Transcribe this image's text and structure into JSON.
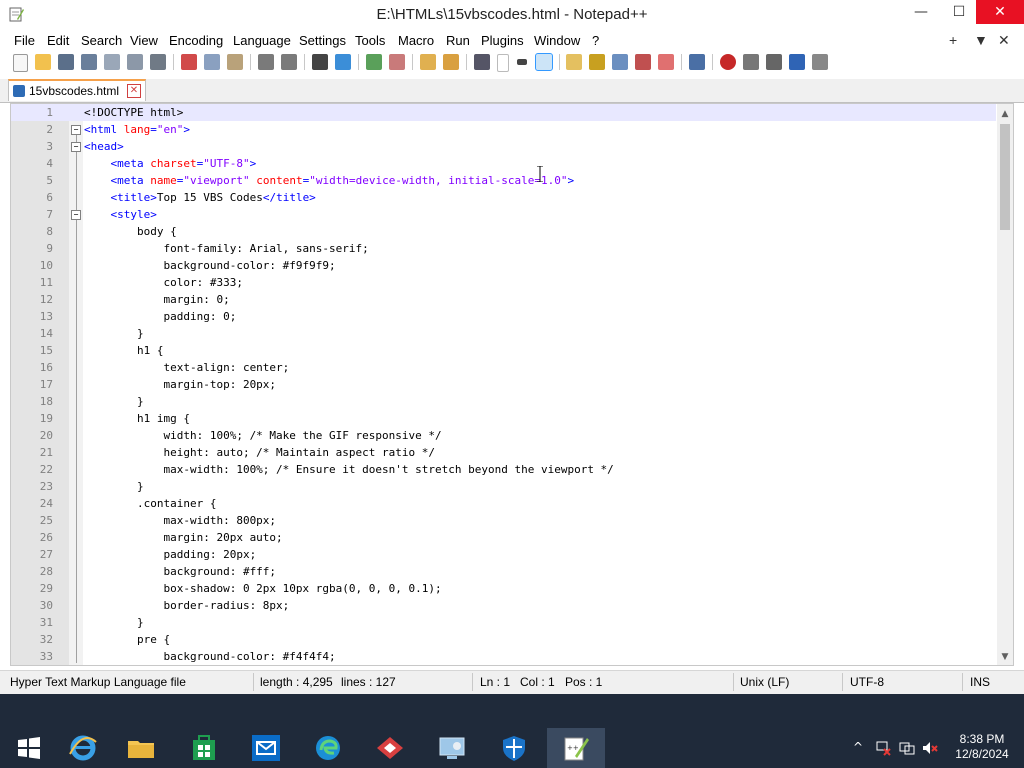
{
  "window": {
    "title": "E:\\HTMLs\\15vbscodes.html - Notepad++",
    "minimize_glyph": "—",
    "maximize_glyph": "☐",
    "close_glyph": "✕"
  },
  "menu": {
    "items": [
      "File",
      "Edit",
      "Search",
      "View",
      "Encoding",
      "Language",
      "Settings",
      "Tools",
      "Macro",
      "Run",
      "Plugins",
      "Window",
      "?"
    ],
    "right": [
      "+",
      "▼",
      "✕"
    ]
  },
  "tab": {
    "label": "15vbscodes.html",
    "close_glyph": "✕"
  },
  "editor": {
    "lines": [
      [
        [
          "doc",
          "<!DOCTYPE html>"
        ]
      ],
      [
        [
          "tag",
          "<html "
        ],
        [
          "attr",
          "lang"
        ],
        [
          "tag",
          "="
        ],
        [
          "val",
          "\"en\""
        ],
        [
          "tag",
          ">"
        ]
      ],
      [
        [
          "tag",
          "<head>"
        ]
      ],
      [
        [
          "sp",
          "    "
        ],
        [
          "tag",
          "<meta "
        ],
        [
          "attr",
          "charset"
        ],
        [
          "tag",
          "="
        ],
        [
          "val",
          "\"UTF-8\""
        ],
        [
          "tag",
          ">"
        ]
      ],
      [
        [
          "sp",
          "    "
        ],
        [
          "tag",
          "<meta "
        ],
        [
          "attr",
          "name"
        ],
        [
          "tag",
          "="
        ],
        [
          "val",
          "\"viewport\" "
        ],
        [
          "attr",
          "content"
        ],
        [
          "tag",
          "="
        ],
        [
          "val",
          "\"width=device-width, initial-scale=1.0\""
        ],
        [
          "tag",
          ">"
        ]
      ],
      [
        [
          "sp",
          "    "
        ],
        [
          "tag",
          "<title>"
        ],
        [
          "txt",
          "Top 15 VBS Codes"
        ],
        [
          "tag",
          "</title>"
        ]
      ],
      [
        [
          "sp",
          "    "
        ],
        [
          "tag",
          "<style>"
        ]
      ],
      [
        [
          "txt",
          "        body {"
        ]
      ],
      [
        [
          "txt",
          "            font-family: Arial, sans-serif;"
        ]
      ],
      [
        [
          "txt",
          "            background-color: #f9f9f9;"
        ]
      ],
      [
        [
          "txt",
          "            color: #333;"
        ]
      ],
      [
        [
          "txt",
          "            margin: 0;"
        ]
      ],
      [
        [
          "txt",
          "            padding: 0;"
        ]
      ],
      [
        [
          "txt",
          "        }"
        ]
      ],
      [
        [
          "txt",
          "        h1 {"
        ]
      ],
      [
        [
          "txt",
          "            text-align: center;"
        ]
      ],
      [
        [
          "txt",
          "            margin-top: 20px;"
        ]
      ],
      [
        [
          "txt",
          "        }"
        ]
      ],
      [
        [
          "txt",
          "        h1 img {"
        ]
      ],
      [
        [
          "txt",
          "            width: 100%; /* Make the GIF responsive */"
        ]
      ],
      [
        [
          "txt",
          "            height: auto; /* Maintain aspect ratio */"
        ]
      ],
      [
        [
          "txt",
          "            max-width: 100%; /* Ensure it doesn't stretch beyond the viewport */"
        ]
      ],
      [
        [
          "txt",
          "        }"
        ]
      ],
      [
        [
          "txt",
          "        .container {"
        ]
      ],
      [
        [
          "txt",
          "            max-width: 800px;"
        ]
      ],
      [
        [
          "txt",
          "            margin: 20px auto;"
        ]
      ],
      [
        [
          "txt",
          "            padding: 20px;"
        ]
      ],
      [
        [
          "txt",
          "            background: #fff;"
        ]
      ],
      [
        [
          "txt",
          "            box-shadow: 0 2px 10px rgba(0, 0, 0, 0.1);"
        ]
      ],
      [
        [
          "txt",
          "            border-radius: 8px;"
        ]
      ],
      [
        [
          "txt",
          "        }"
        ]
      ],
      [
        [
          "txt",
          "        pre {"
        ]
      ],
      [
        [
          "txt",
          "            background-color: #f4f4f4;"
        ]
      ]
    ],
    "line_numbers": [
      "1",
      "2",
      "3",
      "4",
      "5",
      "6",
      "7",
      "8",
      "9",
      "10",
      "11",
      "12",
      "13",
      "14",
      "15",
      "16",
      "17",
      "18",
      "19",
      "20",
      "21",
      "22",
      "23",
      "24",
      "25",
      "26",
      "27",
      "28",
      "29",
      "30",
      "31",
      "32",
      "33"
    ],
    "fold_markers": [
      "2",
      "3",
      "7"
    ],
    "fold_glyph": "−"
  },
  "status": {
    "file_type": "Hyper Text Markup Language file",
    "length": "length : 4,295",
    "lines": "lines : 127",
    "ln": "Ln : 1",
    "col": "Col : 1",
    "pos": "Pos : 1",
    "eol": "Unix (LF)",
    "encoding": "UTF-8",
    "mode": "INS"
  },
  "taskbar": {
    "apps": [
      "start-icon",
      "internet-explorer-icon",
      "file-explorer-icon",
      "store-icon",
      "mail-icon",
      "edge-icon",
      "app-red-icon",
      "control-panel-icon",
      "defender-icon",
      "notepadpp-icon"
    ],
    "tray_up": "^",
    "time": "8:38 PM",
    "date": "12/8/2024"
  },
  "colors": {
    "tag": "#0000ff",
    "attr": "#ff0000",
    "value": "#8000ff",
    "tab_accent": "#f6a14a",
    "close_red": "#e81123",
    "taskbar": "#1f2a3a"
  }
}
